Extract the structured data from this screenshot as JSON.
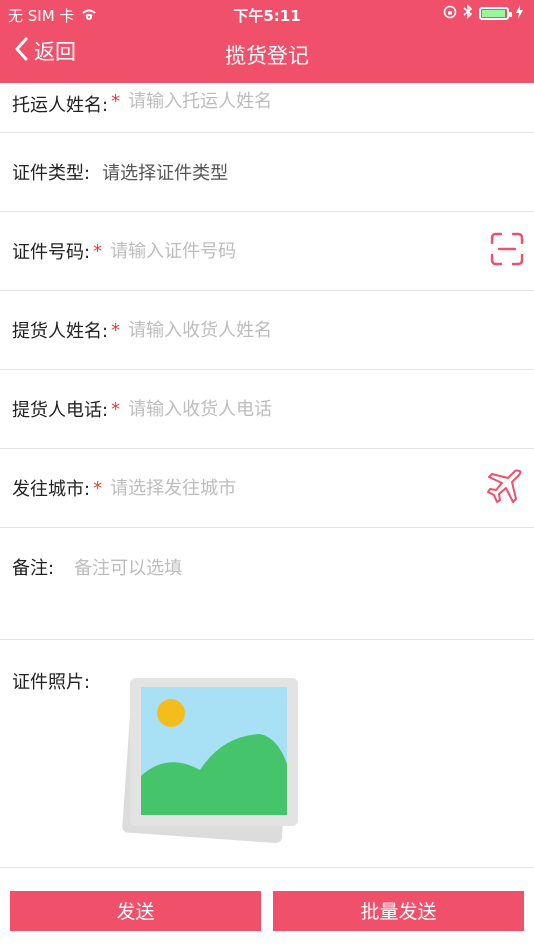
{
  "status_bar": {
    "carrier": "无 SIM 卡",
    "time": "下午5:11",
    "battery_level": 0.95
  },
  "nav": {
    "back_label": "返回",
    "title": "揽货登记"
  },
  "form": {
    "shipper_name": {
      "label": "托运人姓名:",
      "required": "*",
      "placeholder": "请输入托运人姓名"
    },
    "id_type": {
      "label": "证件类型:",
      "value": "请选择证件类型"
    },
    "id_number": {
      "label": "证件号码:",
      "required": "*",
      "placeholder": "请输入证件号码",
      "icon": "scan-icon"
    },
    "consignee_name": {
      "label": "提货人姓名:",
      "required": "*",
      "placeholder": "请输入收货人姓名"
    },
    "consignee_phone": {
      "label": "提货人电话:",
      "required": "*",
      "placeholder": "请输入收货人电话"
    },
    "destination_city": {
      "label": "发往城市:",
      "required": "*",
      "placeholder": "请选择发往城市",
      "icon": "airplane-icon"
    },
    "remark": {
      "label": "备注:",
      "placeholder": "备注可以选填"
    },
    "id_photo": {
      "label": "证件照片:",
      "icon": "image-placeholder-icon"
    }
  },
  "actions": {
    "send_label": "发送",
    "batch_send_label": "批量发送"
  },
  "colors": {
    "accent": "#f0506a",
    "required": "#e83a3a",
    "placeholder": "#bdbdbd"
  }
}
